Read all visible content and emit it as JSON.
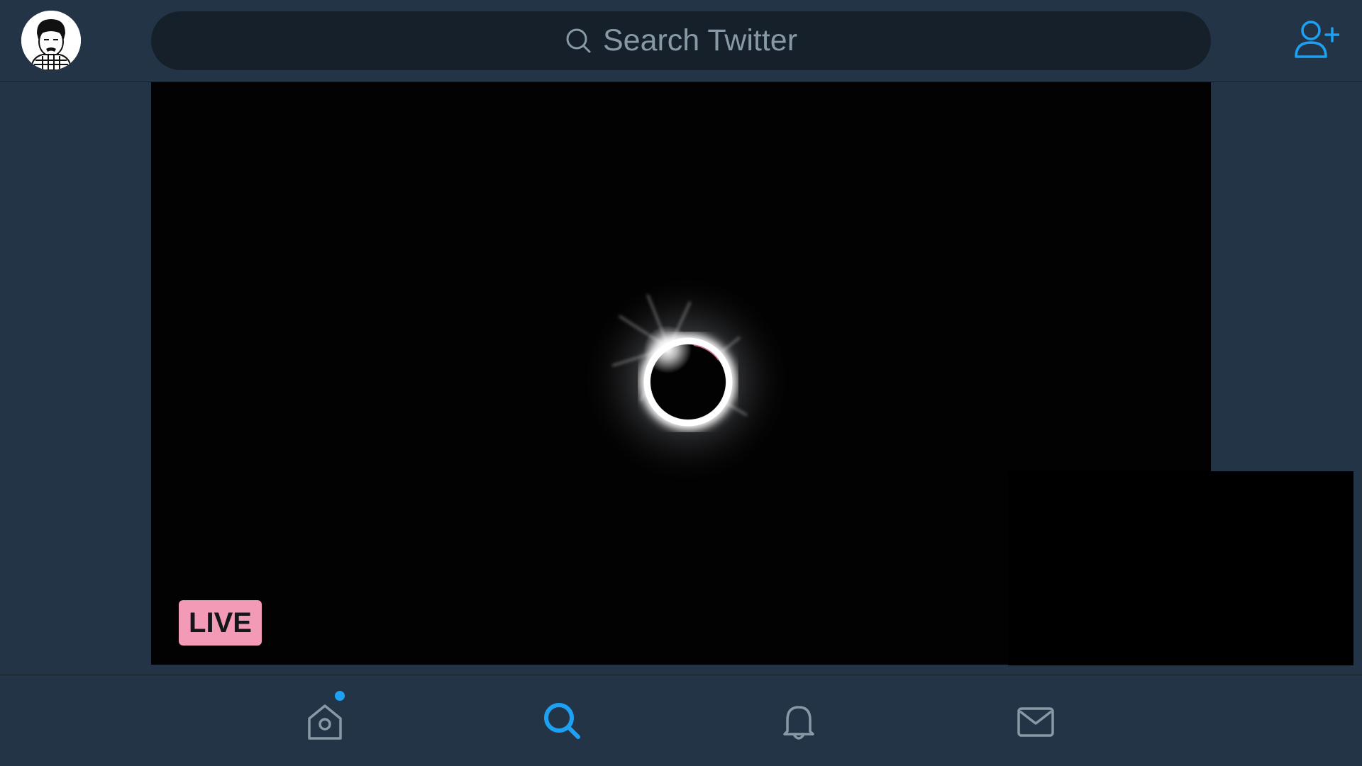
{
  "header": {
    "search": {
      "placeholder": "Search Twitter",
      "icon": "search-icon"
    },
    "avatar": {
      "icon": "user-avatar"
    },
    "add_user": {
      "icon": "add-user-icon"
    }
  },
  "video": {
    "content": "solar eclipse livestream",
    "live_label": "LIVE",
    "live_color": "#f39ab7"
  },
  "tabs": [
    {
      "name": "home",
      "icon": "home-icon",
      "active": false,
      "has_badge": true
    },
    {
      "name": "search",
      "icon": "search-icon",
      "active": true
    },
    {
      "name": "notifications",
      "icon": "bell-icon",
      "active": false
    },
    {
      "name": "messages",
      "icon": "mail-icon",
      "active": false
    }
  ],
  "colors": {
    "background": "#243447",
    "accent": "#1da1f2",
    "muted": "#8899a6",
    "search_bg": "#15202b"
  }
}
